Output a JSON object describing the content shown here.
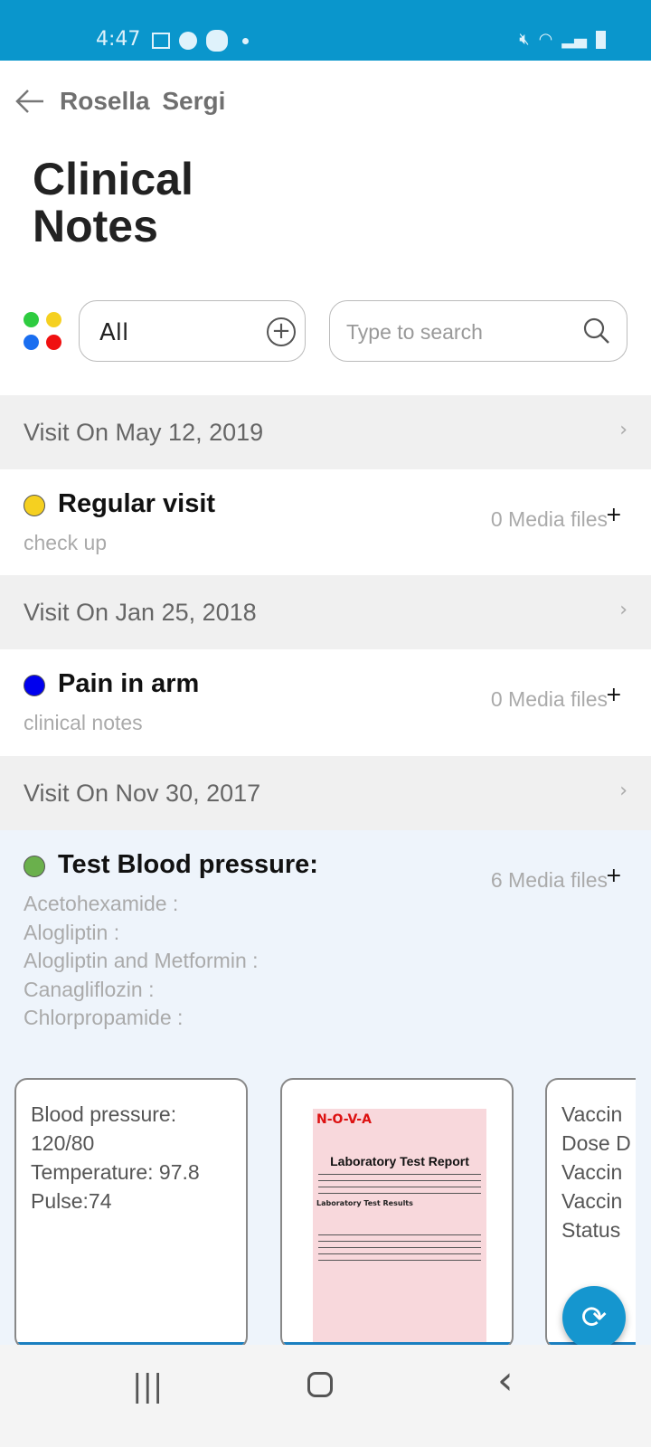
{
  "status_bar": {
    "time": "4:47",
    "left_icons": [
      "image-icon",
      "account-icon",
      "bubble-icon",
      "dot-icon"
    ],
    "right_icons": [
      "mute-icon",
      "wifi-icon",
      "signal-icon",
      "battery-icon"
    ]
  },
  "header": {
    "patient_name": "Rosella  Sergi",
    "title_line1": "Clinical",
    "title_line2": "Notes"
  },
  "filter": {
    "value": "All",
    "color_dots": [
      "#2ecc40",
      "#f5d020",
      "#1a6ef0",
      "#f01010"
    ]
  },
  "search": {
    "placeholder": "Type to search"
  },
  "visits": [
    {
      "date": "Visit On May 12, 2019",
      "title": "Regular visit",
      "color": "#f5d020",
      "notes": [
        "check up"
      ],
      "media": "0 Media files"
    },
    {
      "date": "Visit On Jan 25, 2018",
      "title": "Pain in arm",
      "color": "#0000ee",
      "notes": [
        "clinical notes"
      ],
      "media": "0 Media files"
    },
    {
      "date": "Visit On Nov 30, 2017",
      "title": "Test Blood pressure:",
      "color": "#6ab04c",
      "notes": [
        "Acetohexamide :",
        "Alogliptin :",
        "Alogliptin and Metformin :",
        "Canagliflozin :",
        "Chlorpropamide :"
      ],
      "media": "6 Media files"
    }
  ],
  "media_cards": [
    {
      "text": "Blood pressure:\n120/80\nTemperature: 97.8\nPulse:74"
    },
    {
      "doc_brand": "N-O-V-A",
      "doc_title": "Laboratory Test Report",
      "doc_section": "Laboratory Test Results"
    },
    {
      "text": "Vaccin\nDose D\nVaccin\nVaccin\nStatus"
    }
  ],
  "fab": {
    "icon": "sync-icon"
  },
  "nav": {
    "recents": "|||",
    "home": "○",
    "back": "‹"
  }
}
